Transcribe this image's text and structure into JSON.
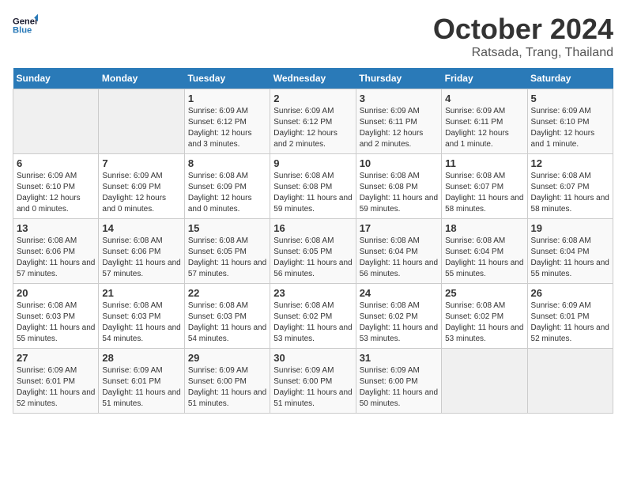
{
  "header": {
    "logo_line1": "General",
    "logo_line2": "Blue",
    "month": "October 2024",
    "location": "Ratsada, Trang, Thailand"
  },
  "days_of_week": [
    "Sunday",
    "Monday",
    "Tuesday",
    "Wednesday",
    "Thursday",
    "Friday",
    "Saturday"
  ],
  "weeks": [
    [
      {
        "day": "",
        "detail": ""
      },
      {
        "day": "",
        "detail": ""
      },
      {
        "day": "1",
        "detail": "Sunrise: 6:09 AM\nSunset: 6:12 PM\nDaylight: 12 hours and 3 minutes."
      },
      {
        "day": "2",
        "detail": "Sunrise: 6:09 AM\nSunset: 6:12 PM\nDaylight: 12 hours and 2 minutes."
      },
      {
        "day": "3",
        "detail": "Sunrise: 6:09 AM\nSunset: 6:11 PM\nDaylight: 12 hours and 2 minutes."
      },
      {
        "day": "4",
        "detail": "Sunrise: 6:09 AM\nSunset: 6:11 PM\nDaylight: 12 hours and 1 minute."
      },
      {
        "day": "5",
        "detail": "Sunrise: 6:09 AM\nSunset: 6:10 PM\nDaylight: 12 hours and 1 minute."
      }
    ],
    [
      {
        "day": "6",
        "detail": "Sunrise: 6:09 AM\nSunset: 6:10 PM\nDaylight: 12 hours and 0 minutes."
      },
      {
        "day": "7",
        "detail": "Sunrise: 6:09 AM\nSunset: 6:09 PM\nDaylight: 12 hours and 0 minutes."
      },
      {
        "day": "8",
        "detail": "Sunrise: 6:08 AM\nSunset: 6:09 PM\nDaylight: 12 hours and 0 minutes."
      },
      {
        "day": "9",
        "detail": "Sunrise: 6:08 AM\nSunset: 6:08 PM\nDaylight: 11 hours and 59 minutes."
      },
      {
        "day": "10",
        "detail": "Sunrise: 6:08 AM\nSunset: 6:08 PM\nDaylight: 11 hours and 59 minutes."
      },
      {
        "day": "11",
        "detail": "Sunrise: 6:08 AM\nSunset: 6:07 PM\nDaylight: 11 hours and 58 minutes."
      },
      {
        "day": "12",
        "detail": "Sunrise: 6:08 AM\nSunset: 6:07 PM\nDaylight: 11 hours and 58 minutes."
      }
    ],
    [
      {
        "day": "13",
        "detail": "Sunrise: 6:08 AM\nSunset: 6:06 PM\nDaylight: 11 hours and 57 minutes."
      },
      {
        "day": "14",
        "detail": "Sunrise: 6:08 AM\nSunset: 6:06 PM\nDaylight: 11 hours and 57 minutes."
      },
      {
        "day": "15",
        "detail": "Sunrise: 6:08 AM\nSunset: 6:05 PM\nDaylight: 11 hours and 57 minutes."
      },
      {
        "day": "16",
        "detail": "Sunrise: 6:08 AM\nSunset: 6:05 PM\nDaylight: 11 hours and 56 minutes."
      },
      {
        "day": "17",
        "detail": "Sunrise: 6:08 AM\nSunset: 6:04 PM\nDaylight: 11 hours and 56 minutes."
      },
      {
        "day": "18",
        "detail": "Sunrise: 6:08 AM\nSunset: 6:04 PM\nDaylight: 11 hours and 55 minutes."
      },
      {
        "day": "19",
        "detail": "Sunrise: 6:08 AM\nSunset: 6:04 PM\nDaylight: 11 hours and 55 minutes."
      }
    ],
    [
      {
        "day": "20",
        "detail": "Sunrise: 6:08 AM\nSunset: 6:03 PM\nDaylight: 11 hours and 55 minutes."
      },
      {
        "day": "21",
        "detail": "Sunrise: 6:08 AM\nSunset: 6:03 PM\nDaylight: 11 hours and 54 minutes."
      },
      {
        "day": "22",
        "detail": "Sunrise: 6:08 AM\nSunset: 6:03 PM\nDaylight: 11 hours and 54 minutes."
      },
      {
        "day": "23",
        "detail": "Sunrise: 6:08 AM\nSunset: 6:02 PM\nDaylight: 11 hours and 53 minutes."
      },
      {
        "day": "24",
        "detail": "Sunrise: 6:08 AM\nSunset: 6:02 PM\nDaylight: 11 hours and 53 minutes."
      },
      {
        "day": "25",
        "detail": "Sunrise: 6:08 AM\nSunset: 6:02 PM\nDaylight: 11 hours and 53 minutes."
      },
      {
        "day": "26",
        "detail": "Sunrise: 6:09 AM\nSunset: 6:01 PM\nDaylight: 11 hours and 52 minutes."
      }
    ],
    [
      {
        "day": "27",
        "detail": "Sunrise: 6:09 AM\nSunset: 6:01 PM\nDaylight: 11 hours and 52 minutes."
      },
      {
        "day": "28",
        "detail": "Sunrise: 6:09 AM\nSunset: 6:01 PM\nDaylight: 11 hours and 51 minutes."
      },
      {
        "day": "29",
        "detail": "Sunrise: 6:09 AM\nSunset: 6:00 PM\nDaylight: 11 hours and 51 minutes."
      },
      {
        "day": "30",
        "detail": "Sunrise: 6:09 AM\nSunset: 6:00 PM\nDaylight: 11 hours and 51 minutes."
      },
      {
        "day": "31",
        "detail": "Sunrise: 6:09 AM\nSunset: 6:00 PM\nDaylight: 11 hours and 50 minutes."
      },
      {
        "day": "",
        "detail": ""
      },
      {
        "day": "",
        "detail": ""
      }
    ]
  ]
}
